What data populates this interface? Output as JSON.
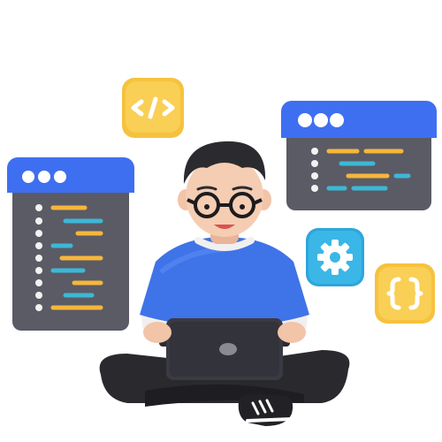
{
  "colors": {
    "background": "#ffffff",
    "window_body": "#5a5a64",
    "window_header": "#3f6ff1",
    "window_dot": "#ffffff",
    "code_orange": "#f6b63b",
    "code_teal": "#3cb8d6",
    "code_white": "#f2f2f2",
    "yellow_badge": "#f6c23e",
    "blue_badge": "#3ab7e6",
    "shirt": "#3f73e8",
    "skin": "#f2c4a8",
    "hair": "#2b2b2f",
    "pants": "#2a2a2e",
    "laptop": "#3a3a44"
  },
  "icons": {
    "left_window": "code-window-icon",
    "right_window": "code-window-icon",
    "html_tag_badge": "html-tag-icon",
    "gear_badge": "gear-icon",
    "braces_badge": "curly-braces-icon",
    "laptop_logo": "apple-logo-icon"
  }
}
